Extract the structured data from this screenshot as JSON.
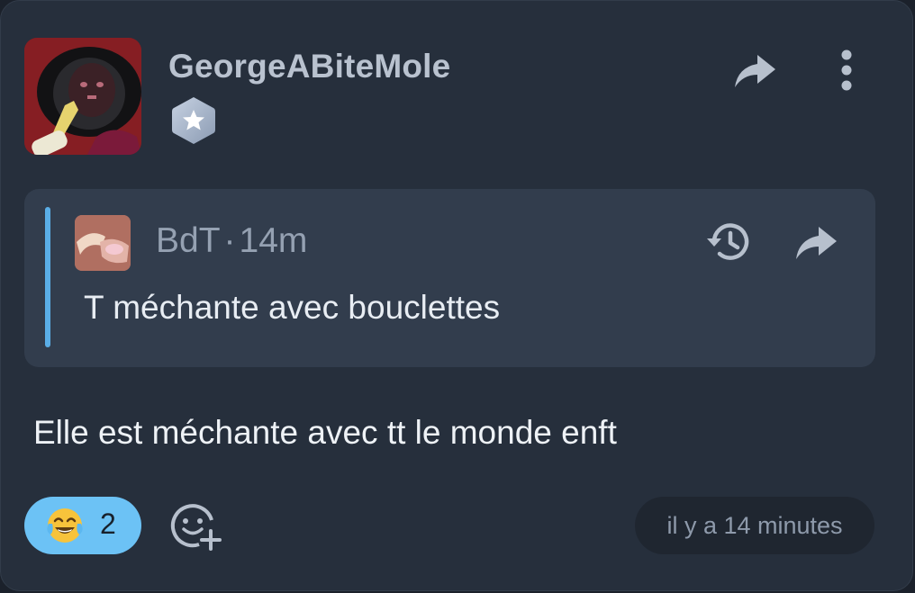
{
  "post": {
    "author": "GeorgeABiteMole",
    "avatar_icon": "profile-photo",
    "badge_icon": "star-hexagon-badge-icon",
    "actions": {
      "share_icon": "share-arrow-icon",
      "more_icon": "vertical-dots-icon"
    }
  },
  "quote": {
    "author": "BdT",
    "separator": "·",
    "time": "14m",
    "text": "T méchante avec bouclettes",
    "accent_color": "#5aaee7",
    "actions": {
      "history_icon": "history-icon",
      "share_icon": "share-arrow-icon"
    }
  },
  "message": "Elle est méchante avec tt le monde enft",
  "reactions": [
    {
      "emoji": "😂",
      "count": "2",
      "selected": true,
      "color": "#6cc2f5"
    }
  ],
  "add_reaction_icon": "add-emoji-icon",
  "timestamp": "il y a 14 minutes"
}
